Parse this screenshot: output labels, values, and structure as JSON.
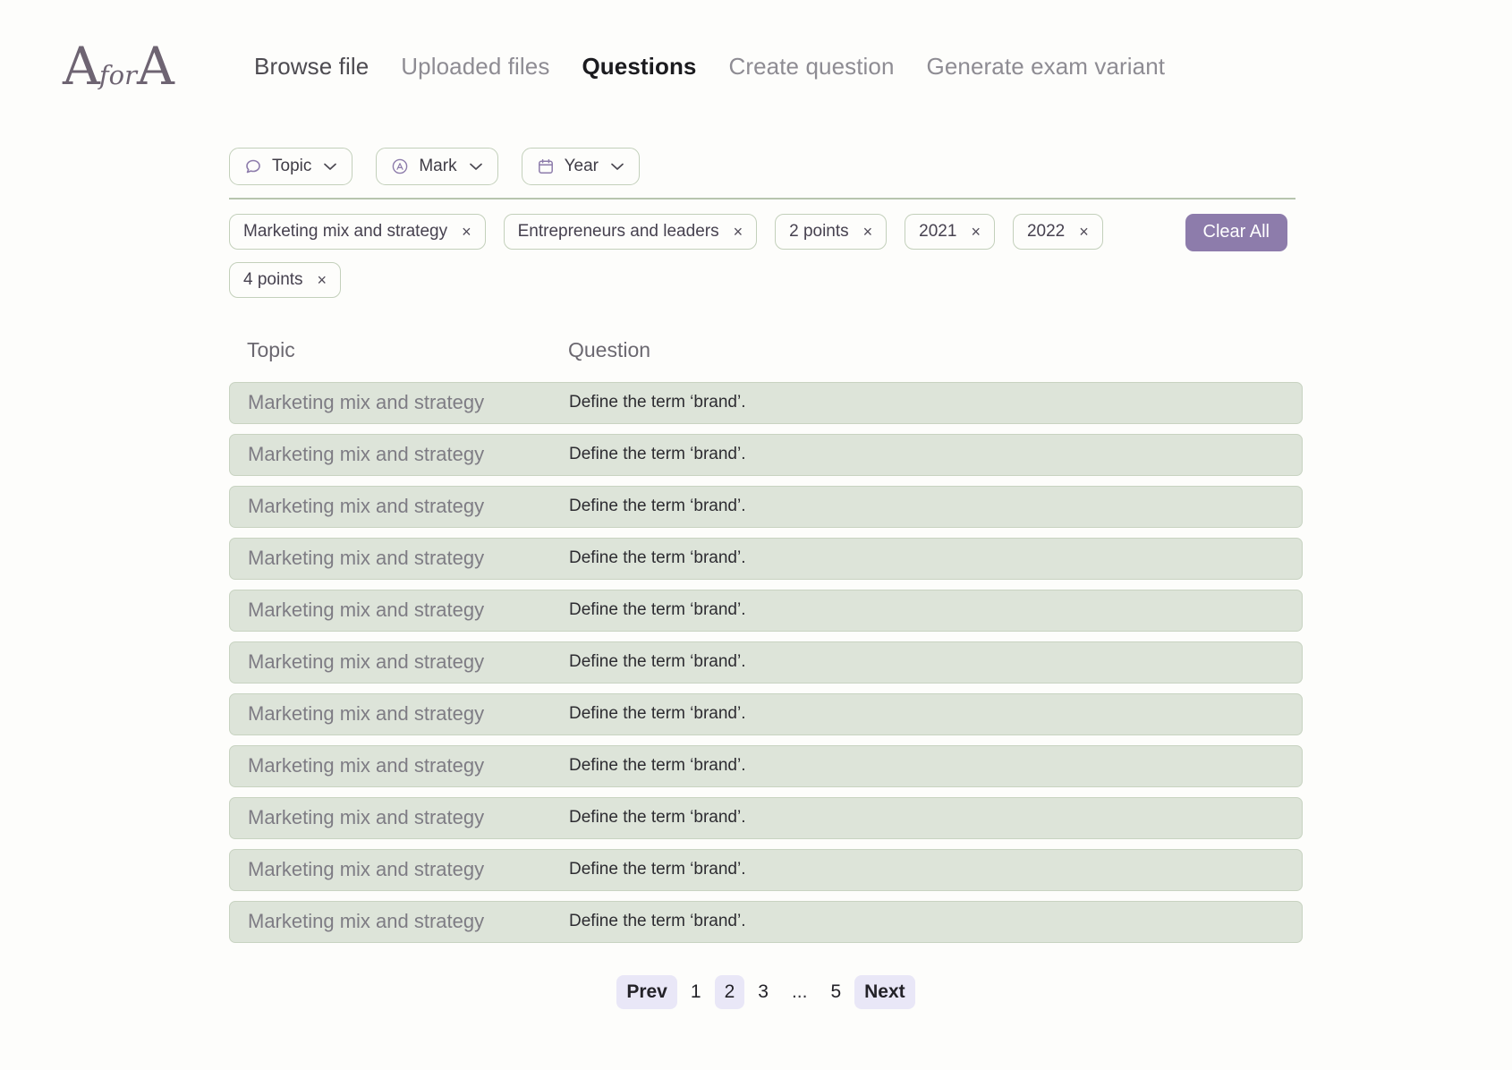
{
  "brand": {
    "logo_first": "A",
    "logo_middle": "for",
    "logo_last": "A",
    "accent_purple": "#8d7cab",
    "chip_border_green": "#c3d0bb",
    "row_bg_green": "#dde4d9",
    "pagination_active_bg": "#e9e7f7"
  },
  "nav": {
    "items": [
      {
        "label": "Browse file",
        "state": "dim-strong"
      },
      {
        "label": "Uploaded files",
        "state": "dim"
      },
      {
        "label": "Questions",
        "state": "active"
      },
      {
        "label": "Create question",
        "state": "dim"
      },
      {
        "label": "Generate exam variant",
        "state": "dim"
      }
    ]
  },
  "filters": {
    "buttons": [
      {
        "label": "Topic",
        "icon": "speech-bubble-icon",
        "caret": "⌄"
      },
      {
        "label": "Mark",
        "icon": "circled-a-icon",
        "caret": "⌄"
      },
      {
        "label": "Year",
        "icon": "calendar-icon",
        "caret": "⌄"
      }
    ],
    "chips": [
      {
        "label": "Marketing mix and strategy",
        "remove": "×"
      },
      {
        "label": "Entrepreneurs and leaders",
        "remove": "×"
      },
      {
        "label": "2 points",
        "remove": "×"
      },
      {
        "label": "2021",
        "remove": "×"
      },
      {
        "label": "2022",
        "remove": "×"
      },
      {
        "label": "4 points",
        "remove": "×"
      }
    ],
    "clear_all_label": "Clear All"
  },
  "table": {
    "columns": [
      "Topic",
      "Question"
    ],
    "rows": [
      {
        "topic": "Marketing mix and strategy",
        "question": "Define the term ‘brand’."
      },
      {
        "topic": "Marketing mix and strategy",
        "question": "Define the term ‘brand’."
      },
      {
        "topic": "Marketing mix and strategy",
        "question": "Define the term ‘brand’."
      },
      {
        "topic": "Marketing mix and strategy",
        "question": "Define the term ‘brand’."
      },
      {
        "topic": "Marketing mix and strategy",
        "question": "Define the term ‘brand’."
      },
      {
        "topic": "Marketing mix and strategy",
        "question": "Define the term ‘brand’."
      },
      {
        "topic": "Marketing mix and strategy",
        "question": "Define the term ‘brand’."
      },
      {
        "topic": "Marketing mix and strategy",
        "question": "Define the term ‘brand’."
      },
      {
        "topic": "Marketing mix and strategy",
        "question": "Define the term ‘brand’."
      },
      {
        "topic": "Marketing mix and strategy",
        "question": "Define the term ‘brand’."
      },
      {
        "topic": "Marketing mix and strategy",
        "question": "Define the term ‘brand’."
      }
    ]
  },
  "pagination": {
    "prev_label": "Prev",
    "next_label": "Next",
    "pages": [
      "1",
      "2",
      "3",
      "...",
      "5"
    ],
    "current_page": "2"
  }
}
